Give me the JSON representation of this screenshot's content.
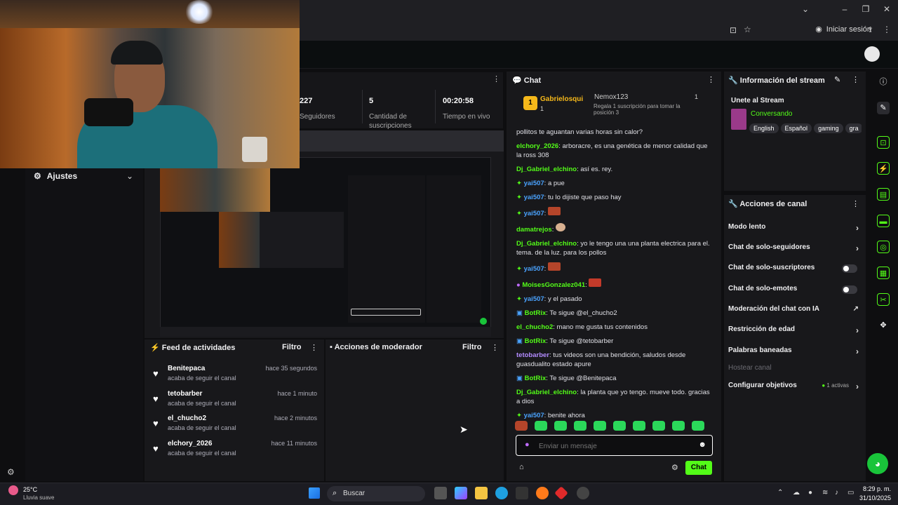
{
  "browser": {
    "signin_label": "Iniciar sesión"
  },
  "stats": [
    {
      "value": "227",
      "label": "Seguidores"
    },
    {
      "value": "5",
      "label": "Cantidad de suscripciones"
    },
    {
      "value": "00:20:58",
      "label": "Tiempo en vivo"
    }
  ],
  "sidebar": {
    "settings_label": "Ajustes"
  },
  "feed": {
    "title": "Feed de actividades",
    "filter": "Filtro",
    "items": [
      {
        "name": "Benitepaca",
        "sub": "acaba de seguir el canal",
        "time": "hace 35 segundos"
      },
      {
        "name": "tetobarber",
        "sub": "acaba de seguir el canal",
        "time": "hace 1 minuto"
      },
      {
        "name": "el_chucho2",
        "sub": "acaba de seguir el canal",
        "time": "hace 2 minutos"
      },
      {
        "name": "elchory_2026",
        "sub": "acaba de seguir el canal",
        "time": "hace 11 minutos"
      }
    ]
  },
  "moderator": {
    "title": "Acciones de moderador",
    "filter": "Filtro"
  },
  "chat": {
    "title": "Chat",
    "top_gifter": {
      "name": "Gabrielosqui",
      "count": "1",
      "rank": "1"
    },
    "second_gifter": {
      "name": "Nemox123",
      "count": "1",
      "note": "Regala 1 suscripción para tomar la posición 3"
    },
    "messages": [
      {
        "user": "",
        "text": "pollitos te aguantan varias horas sin calor?",
        "color": "#e0e0e6"
      },
      {
        "user": "elchory_2026",
        "text": ": arboracre, es una genética de menor calidad que la ross 308",
        "color": "#53fc18"
      },
      {
        "user": "Dj_Gabriel_elchino",
        "text": ": así es. rey.",
        "color": "#53fc18"
      },
      {
        "user": "yai507",
        "text": ": a pue",
        "color": "#4aa3ff"
      },
      {
        "user": "yai507",
        "text": ": tu lo dijiste que paso hay",
        "color": "#4aa3ff"
      },
      {
        "user": "yai507",
        "text": ":",
        "color": "#4aa3ff"
      },
      {
        "user": "damatrejos",
        "text": ":",
        "color": "#53fc18"
      },
      {
        "user": "Dj_Gabriel_elchino",
        "text": ": yo le tengo una una planta electrica para el. tema. de la luz. para los pollos",
        "color": "#53fc18"
      },
      {
        "user": "yai507",
        "text": ":",
        "color": "#4aa3ff"
      },
      {
        "user": "MoisesGonzalez041",
        "text": ":",
        "color": "#53fc18"
      },
      {
        "user": "yai507",
        "text": ": y el pasado",
        "color": "#4aa3ff"
      },
      {
        "user": "BotRix",
        "text": ": Te sigue @el_chucho2",
        "color": "#53fc18"
      },
      {
        "user": "el_chucho2",
        "text": ": mano me gusta tus contenidos",
        "color": "#53fc18"
      },
      {
        "user": "BotRix",
        "text": ": Te sigue @tetobarber",
        "color": "#53fc18"
      },
      {
        "user": "tetobarber",
        "text": ": tus videos son una bendición, saludos desde guasdualito estado apure",
        "color": "#b38bff"
      },
      {
        "user": "BotRix",
        "text": ": Te sigue @Benitepaca",
        "color": "#53fc18"
      },
      {
        "user": "Dj_Gabriel_elchino",
        "text": ": la planta que yo tengo. mueve todo. gracias a dios",
        "color": "#53fc18"
      },
      {
        "user": "yai507",
        "text": ": benite ahora",
        "color": "#4aa3ff"
      }
    ],
    "input_placeholder": "Enviar un mensaje",
    "send_label": "Chat"
  },
  "stream_info": {
    "title": "Información del stream",
    "join": "Unete al Stream",
    "category": "Conversando",
    "tags": [
      "English",
      "Español",
      "gaming",
      "gra"
    ]
  },
  "channel_actions": {
    "title": "Acciones de canal",
    "items": [
      {
        "label": "Modo lento",
        "kind": "chevron"
      },
      {
        "label": "Chat de solo-seguidores",
        "kind": "chevron"
      },
      {
        "label": "Chat de solo-suscriptores",
        "kind": "toggle"
      },
      {
        "label": "Chat de solo-emotes",
        "kind": "toggle"
      },
      {
        "label": "Moderación del chat con IA",
        "kind": "external"
      },
      {
        "label": "Restricción de edad",
        "kind": "chevron"
      },
      {
        "label": "Palabras baneadas",
        "kind": "chevron"
      },
      {
        "label": "Hostear canal",
        "kind": "disabled"
      },
      {
        "label": "Configurar objetivos",
        "kind": "badge",
        "badge": "1 activas"
      }
    ]
  },
  "taskbar": {
    "weather_temp": "25°C",
    "weather_desc": "Lluvia suave",
    "search_label": "Buscar",
    "time": "8:29 p. m.",
    "date": "31/10/2025"
  },
  "colors": {
    "accent": "#53fc18",
    "panel": "#18181b",
    "background": "#0e0e10"
  }
}
